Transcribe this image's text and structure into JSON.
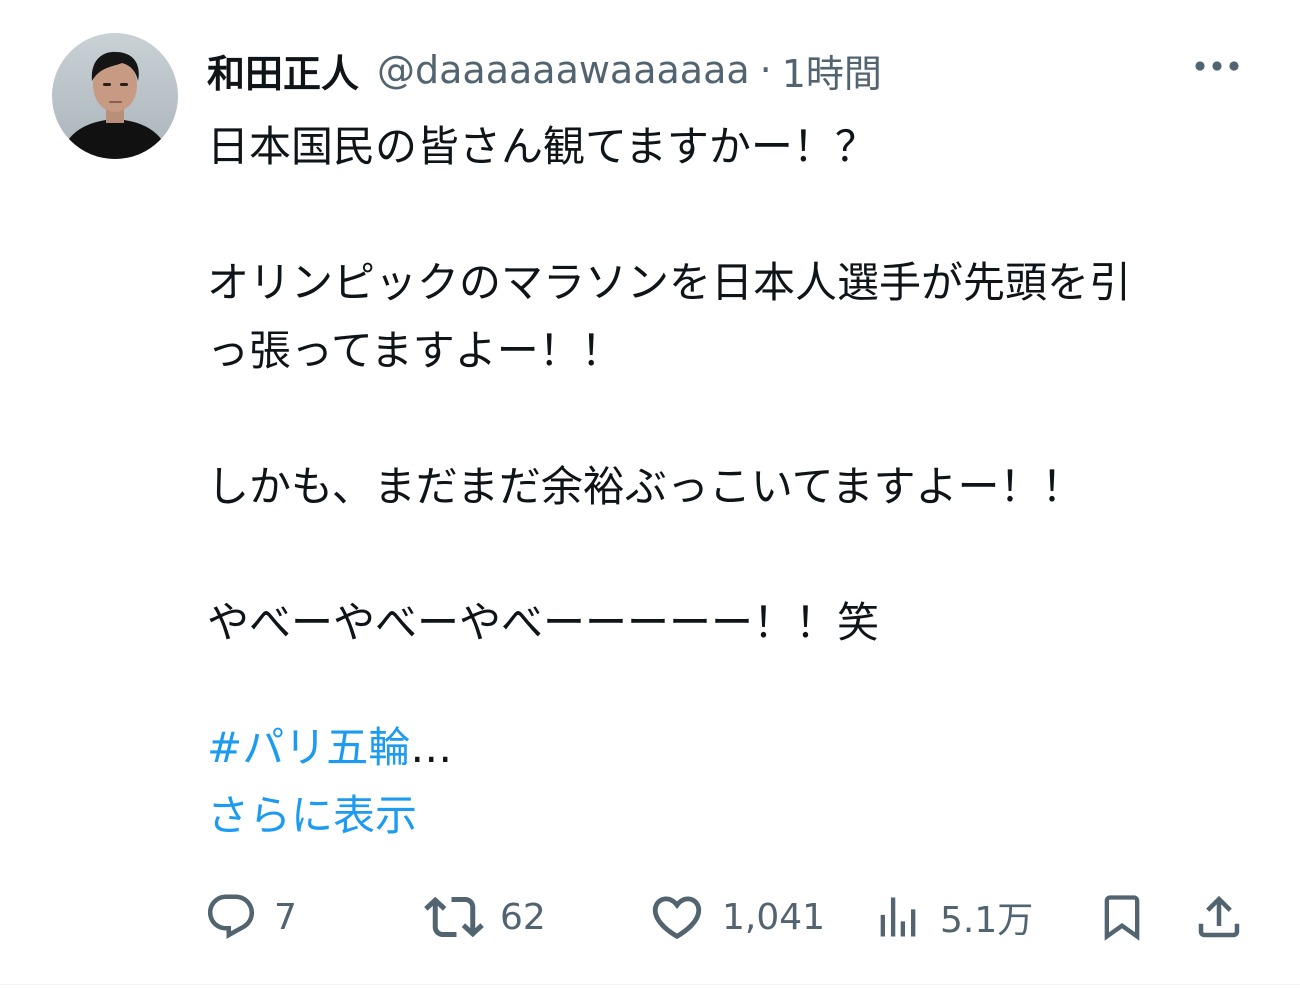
{
  "author": {
    "display_name": "和田正人",
    "handle": "@daaaaaawaaaaaa",
    "separator": "·",
    "time": "1時間"
  },
  "tweet": {
    "lines": [
      "日本国民の皆さん観てますかー！？",
      "オリンピックのマラソンを日本人選手が先頭を引",
      "っ張ってますよー！！",
      "しかも、まだまだ余裕ぶっこいてますよー！！",
      "やべーやべーやべーーーーー！！笑"
    ],
    "hashtag": "#パリ五輪",
    "ellipsis": "…",
    "show_more": "さらに表示"
  },
  "actions": {
    "reply_count": "7",
    "retweet_count": "62",
    "like_count": "1,041",
    "views_count": "5.1万"
  },
  "icons": {
    "more": "more-horizontal-icon",
    "reply": "reply-bubble-icon",
    "retweet": "retweet-arrows-icon",
    "like": "heart-icon",
    "views": "bar-chart-icon",
    "bookmark": "bookmark-icon",
    "share": "share-upload-icon"
  },
  "colors": {
    "text": "#0f1419",
    "secondary": "#536471",
    "link": "#1d9bf0",
    "avatar_background": "#b9c3c8"
  }
}
